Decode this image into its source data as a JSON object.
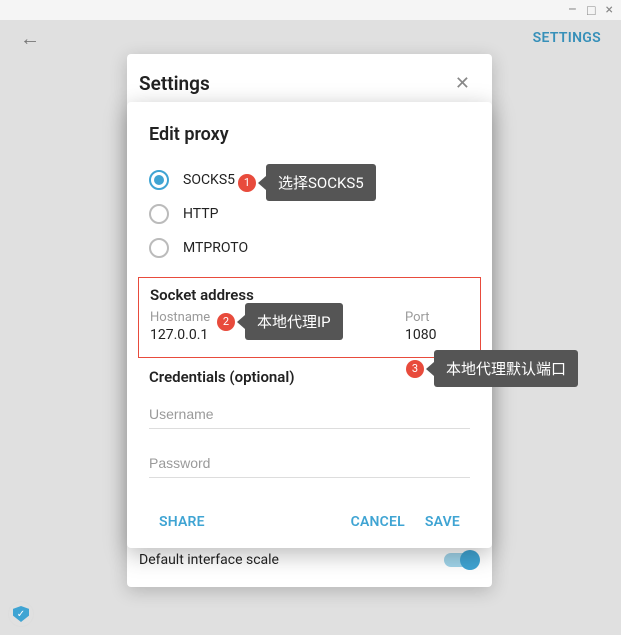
{
  "window_controls": {
    "min": "–",
    "max": "□",
    "close": "×"
  },
  "header": {
    "settings_link": "SETTINGS"
  },
  "settings_panel": {
    "title": "Settings",
    "default_scale": "Default interface scale"
  },
  "dialog": {
    "title": "Edit proxy",
    "radios": {
      "socks5": "SOCKS5",
      "http": "HTTP",
      "mtproto": "MTPROTO"
    },
    "socket_title": "Socket address",
    "hostname_label": "Hostname",
    "hostname_value": "127.0.0.1",
    "port_label": "Port",
    "port_value": "1080",
    "credentials_title": "Credentials (optional)",
    "username_placeholder": "Username",
    "password_placeholder": "Password",
    "share": "SHARE",
    "cancel": "CANCEL",
    "save": "SAVE"
  },
  "annotations": {
    "a1_num": "1",
    "a1_text": "选择SOCKS5",
    "a2_num": "2",
    "a2_text": "本地代理IP",
    "a3_num": "3",
    "a3_text": "本地代理默认端口"
  }
}
